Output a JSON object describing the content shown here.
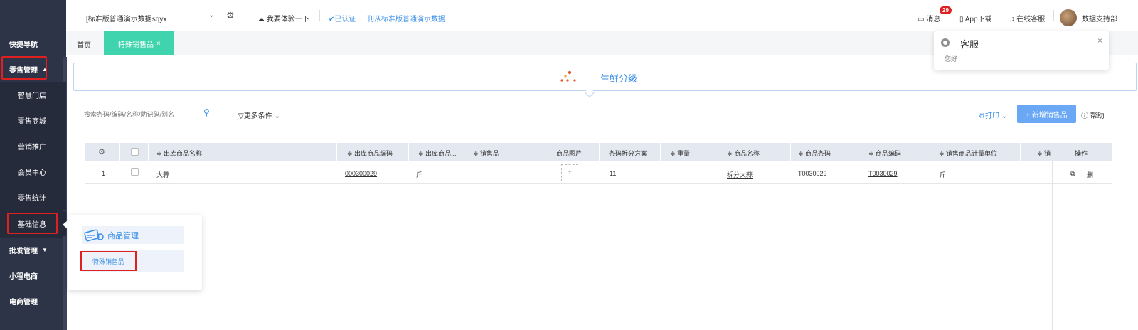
{
  "sidebar": {
    "items": [
      {
        "label": "快捷导航"
      },
      {
        "label": "零售管理",
        "arrow": "▲"
      },
      {
        "label": "智慧门店"
      },
      {
        "label": "零售商城"
      },
      {
        "label": "营销推广"
      },
      {
        "label": "会员中心"
      },
      {
        "label": "零售统计"
      },
      {
        "label": "基础信息"
      },
      {
        "label": "批发管理",
        "arrow": "▼"
      },
      {
        "label": "小程电商"
      },
      {
        "label": "电商管理"
      }
    ]
  },
  "topbar": {
    "store": "[标准版普通演示数据sqyx",
    "caret": "⌄",
    "try_label": "我要体验一下",
    "verified_label": "已认证",
    "demo_label": "刊从标准版普通演示数据",
    "message_label": "消息",
    "message_count": "29",
    "app_label": "App下载",
    "service_label": "在线客服",
    "user_label": "数据支持部"
  },
  "tabs": {
    "home": "首页",
    "active": "特殊销售品",
    "close": "×"
  },
  "banner": {
    "title": "生鲜分级"
  },
  "filters": {
    "search_placeholder": "搜索条码/编码/名称/助记码/别名",
    "more_label": "更多条件",
    "print_label": "打印",
    "add_label": "+ 新增销售品",
    "help_label": "帮助"
  },
  "table": {
    "headers": [
      "≑ 出库商品名称",
      "≑ 出库商品编码",
      "≑ 出库商品...",
      "≑ 销售品",
      "商品图片",
      "条码拆分方案",
      "≑ 重量",
      "≑ 商品名称",
      "≑ 商品条码",
      "≑ 商品编码",
      "≑ 销售商品计量单位",
      "≑ 销",
      "操作"
    ],
    "rows": [
      {
        "index": "1",
        "out_name": "大蒜",
        "out_code": "000300029",
        "out_unit": "斤",
        "image": "+",
        "split": "11",
        "name": "拆分大蒜",
        "barcode": "T0030029",
        "code": "T0030029",
        "unit": "斤",
        "op_copy": "⧉",
        "op_delete": "删"
      }
    ]
  },
  "popup": {
    "group_title": "商品管理",
    "item": "特殊销售品"
  },
  "notification": {
    "title": "客服",
    "body": "您好",
    "close": "×"
  },
  "colors": {
    "sidebar_bg": "#2e3448",
    "accent": "#3a8ee6",
    "tab_active": "#3fd4ae",
    "highlight": "#e02020"
  }
}
